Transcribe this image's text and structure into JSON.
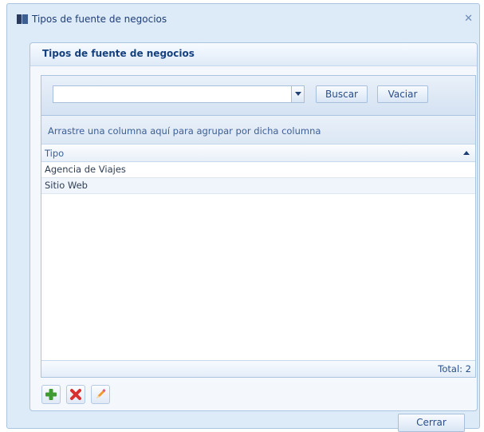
{
  "window": {
    "title": "Tipos de fuente de negocios",
    "close_glyph": "✕"
  },
  "panel": {
    "title": "Tipos de fuente de negocios"
  },
  "search": {
    "value": "",
    "placeholder": "",
    "search_button": "Buscar",
    "clear_button": "Vaciar"
  },
  "grid": {
    "group_hint": "Arrastre una columna aquí para agrupar por dicha columna",
    "columns": [
      "Tipo"
    ],
    "sort_direction": "ascending",
    "rows": [
      "Agencia de Viajes",
      "Sitio Web"
    ],
    "total_text": "Total: 2"
  },
  "actions": {
    "icons": [
      "add-icon",
      "delete-icon",
      "edit-icon"
    ]
  },
  "footer": {
    "close_button": "Cerrar"
  },
  "colors": {
    "frame": "#ddeaf7",
    "border": "#aac4e0",
    "title_text": "#15407f",
    "add": "#3e9b32",
    "delete": "#d83030",
    "edit": "#f19a2a"
  }
}
